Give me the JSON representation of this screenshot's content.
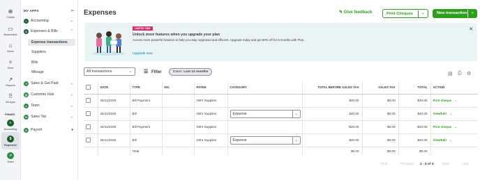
{
  "rail": {
    "create": "Create",
    "bookmarks": "Bookmarks",
    "home": "Home",
    "feed": "Feed",
    "reports": "Reports",
    "all_apps": "All apps",
    "pinned": "PINNED",
    "accounting": "Accounting",
    "expenses": "Expenses",
    "sales": "Sales"
  },
  "sidebar": {
    "heading": "MY APPS",
    "groups": [
      {
        "label": "Accounting"
      },
      {
        "label": "Expenses & Bills"
      },
      {
        "label": "Sales & Get Paid"
      },
      {
        "label": "Customer Hub"
      },
      {
        "label": "Team"
      },
      {
        "label": "Sales Tax"
      },
      {
        "label": "Payroll"
      }
    ],
    "sub_items": [
      "Expense transactions",
      "Suppliers",
      "Bills",
      "Mileage"
    ]
  },
  "header": {
    "title": "Expenses",
    "feedback": "Give feedback",
    "print_cheques": "Print Cheques",
    "new_transaction": "New transaction"
  },
  "banner": {
    "tag": "LIMITED TIME",
    "heading": "Unlock more features when you upgrade your plan",
    "body": "Access more powerful features to help you stay organized and efficient. Upgrade today and get 60% off for 6 months with Plus.",
    "link": "Upgrade now"
  },
  "filters": {
    "select_value": "All transactions",
    "filter_label": "Filter",
    "chip_prefix": "Dates:",
    "chip_value": "Last 12 months"
  },
  "table": {
    "headers": [
      "DATE",
      "TYPE",
      "NO.",
      "PAYEE",
      "CATEGORY",
      "TOTAL BEFORE SALES TAX",
      "SALES TAX",
      "TOTAL",
      "ACTION"
    ],
    "rows": [
      {
        "date": "26/11/2025",
        "type": "Bill Payment",
        "no": "",
        "payee": "GB's Supplies",
        "category": "",
        "before_tax": "$40.00",
        "tax": "$0.00",
        "total": "$40.00",
        "action": "Print cheque"
      },
      {
        "date": "26/11/2025",
        "type": "Bill",
        "no": "",
        "payee": "GB's Supplies",
        "category": "Expense",
        "before_tax": "$40.00",
        "tax": "$0.00",
        "total": "$40.00",
        "action": "View/Edit"
      },
      {
        "date": "26/11/2025",
        "type": "Bill Payment",
        "no": "",
        "payee": "GB's Supplies",
        "category": "",
        "before_tax": "-$20.00",
        "tax": "$0.00",
        "total": "-$20.00",
        "action": "Print cheque"
      },
      {
        "date": "26/11/2025",
        "type": "Bill",
        "no": "",
        "payee": "GB's Supplies",
        "category": "Expense",
        "before_tax": "$20.00",
        "tax": "$0.00",
        "total": "$20.00",
        "action": "View/Edit"
      }
    ],
    "total_row": {
      "label": "Total",
      "before_tax": "$0.00",
      "tax": "$0.00",
      "total": "$0.00"
    }
  },
  "pager": {
    "first": "First",
    "previous": "Previous",
    "range": "1 - 4 of 4",
    "next": "Next",
    "last": "Last"
  },
  "colors": {
    "brand_green": "#2ca01c",
    "dark_green": "#1a5c2e",
    "banner_bg": "#eaf4f5",
    "tag_pink": "#d52b6f",
    "link_blue": "#0077c5"
  }
}
